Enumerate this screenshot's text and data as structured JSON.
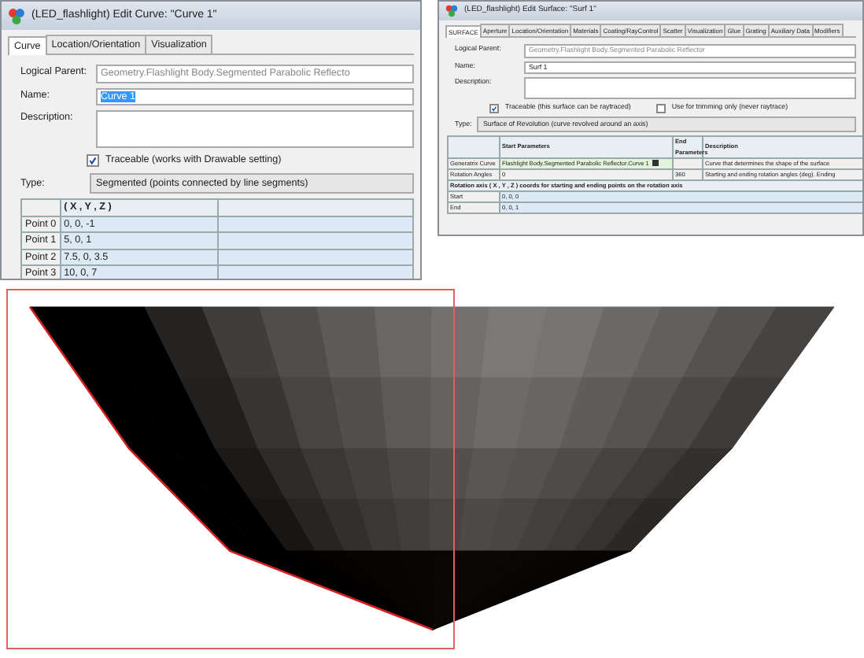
{
  "curve_window": {
    "title": "(LED_flashlight) Edit Curve: \"Curve 1\"",
    "tabs": [
      {
        "label": "Curve",
        "selected": true
      },
      {
        "label": "Location/Orientation",
        "selected": false
      },
      {
        "label": "Visualization",
        "selected": false
      }
    ],
    "fields": [
      {
        "label": "Logical Parent:",
        "value": "Geometry.Flashlight Body.Segmented Parabolic Reflecto",
        "kind": "readonly"
      },
      {
        "label": "Name:",
        "value": "Curve 1",
        "kind": "selected-text"
      },
      {
        "label": "Description:",
        "kind": "textarea"
      }
    ],
    "checkboxes": [
      {
        "label": "Traceable  (works with Drawable setting)",
        "checked": true
      }
    ],
    "type": {
      "label": "Type:",
      "value": "Segmented  (points connected by line segments)"
    },
    "table": {
      "columns": [
        "( X , Y , Z )"
      ],
      "rows": [
        {
          "label": "Point 0",
          "value": "0,  0,  -1"
        },
        {
          "label": "Point 1",
          "value": "5,  0,  1"
        },
        {
          "label": "Point 2",
          "value": "7.5,  0,  3.5"
        },
        {
          "label": "Point 3",
          "value": "10,  0,  7"
        }
      ]
    }
  },
  "surface_window": {
    "title": "(LED_flashlight) Edit Surface: \"Surf 1\"",
    "tabs": [
      {
        "label": "SURFACE",
        "selected": true
      },
      {
        "label": "Aperture",
        "selected": false
      },
      {
        "label": "Location/Orientation",
        "selected": false
      },
      {
        "label": "Materials",
        "selected": false
      },
      {
        "label": "Coating/RayControl",
        "selected": false
      },
      {
        "label": "Scatter",
        "selected": false
      },
      {
        "label": "Visualization",
        "selected": false
      },
      {
        "label": "Glue",
        "selected": false
      },
      {
        "label": "Grating",
        "selected": false
      },
      {
        "label": "Auxiliary Data",
        "selected": false
      },
      {
        "label": "Modifiers",
        "selected": false
      }
    ],
    "fields": [
      {
        "label": "Logical Parent:",
        "value": "Geometry.Flashlight Body.Segmented Parabolic Reflector",
        "kind": "readonly"
      },
      {
        "label": "Name:",
        "value": "Surf 1",
        "kind": "text"
      },
      {
        "label": "Description:",
        "kind": "textarea"
      }
    ],
    "checkboxes": [
      {
        "label": "Traceable (this surface can be raytraced)",
        "checked": true
      },
      {
        "label": "Use for trimming only (never raytrace)",
        "checked": false
      }
    ],
    "type": {
      "label": "Type:",
      "value": "Surface of Revolution  (curve revolved around an axis)"
    },
    "table": {
      "columns": [
        "Start Parameters",
        "End Parameters",
        "Description"
      ],
      "rows": [
        {
          "kind": "param",
          "label": "Generatrix Curve",
          "start": {
            "text": "Flashlight Body.Segmented Parabolic Reflector.Curve 1",
            "kind": "reference"
          },
          "description": "Curve that determines the shape of the surface"
        },
        {
          "kind": "param",
          "label": "Rotation Angles",
          "start": {
            "text": "0",
            "kind": "plain"
          },
          "end": "360",
          "description": "Starting and ending rotation angles (deg).  Ending"
        },
        {
          "kind": "section",
          "text": "Rotation axis ( X , Y , Z ) coords for starting and ending points on the rotation axis"
        },
        {
          "kind": "point",
          "label": "Start",
          "value": "0,  0,  0"
        },
        {
          "kind": "point",
          "label": "End",
          "value": "0,  0,  1"
        }
      ]
    }
  }
}
